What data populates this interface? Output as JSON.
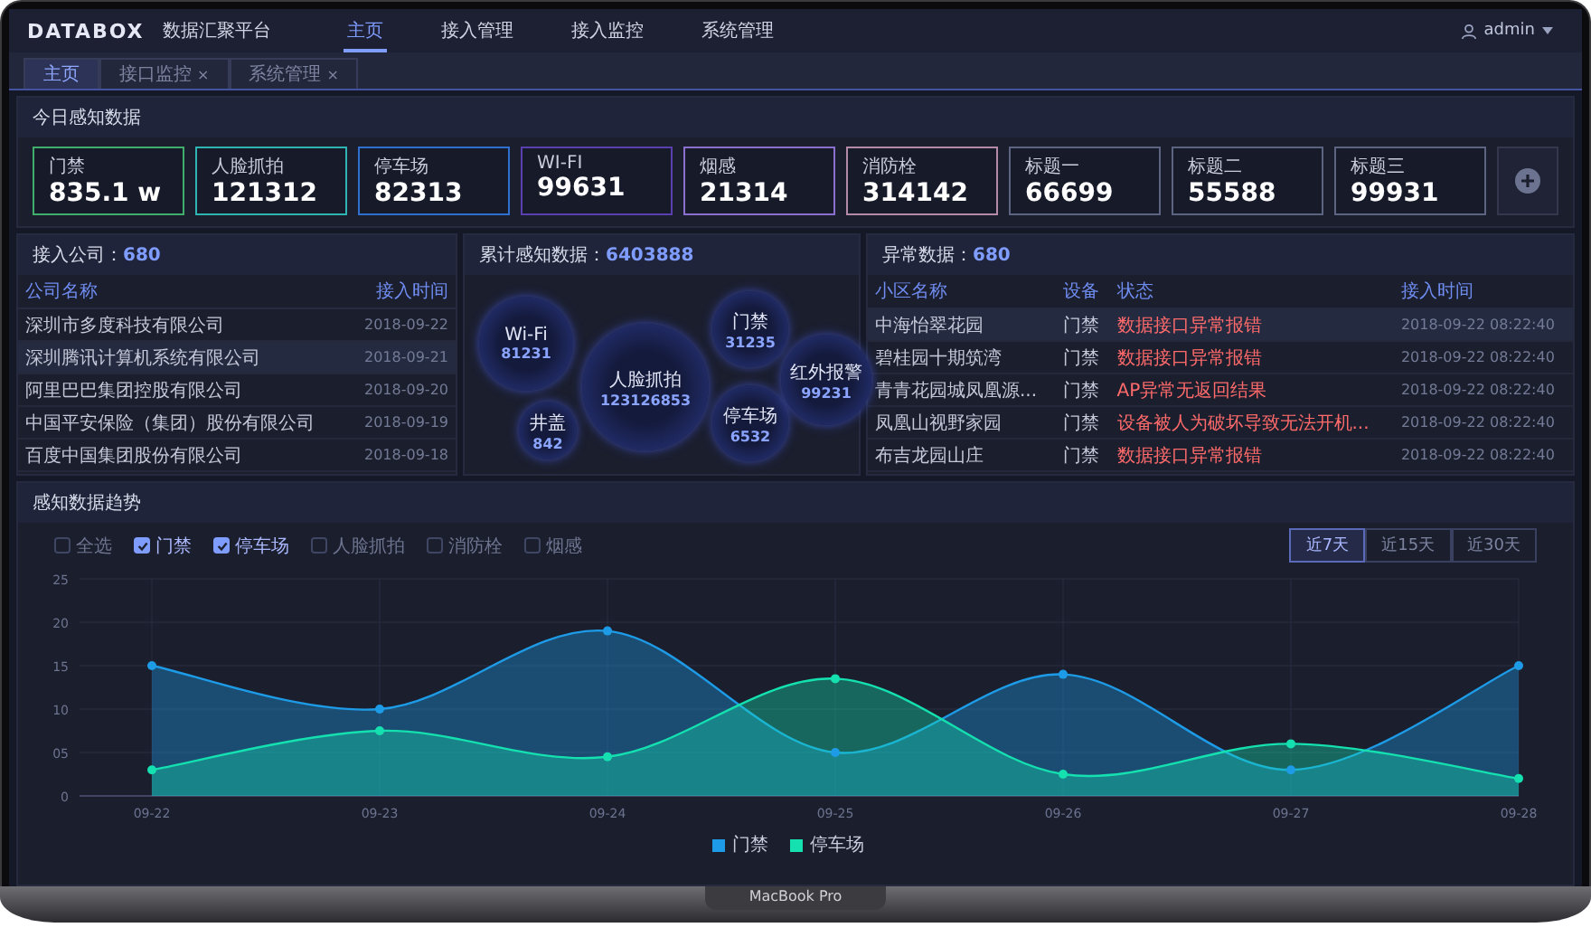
{
  "device": {
    "label": "MacBook Pro"
  },
  "header": {
    "logo": "DATABOX",
    "subtitle": "数据汇聚平台",
    "user": "admin",
    "nav": [
      {
        "label": "主页",
        "selected": true
      },
      {
        "label": "接入管理",
        "selected": false
      },
      {
        "label": "接入监控",
        "selected": false
      },
      {
        "label": "系统管理",
        "selected": false
      }
    ]
  },
  "tabs": [
    {
      "label": "主页",
      "selected": true
    },
    {
      "label": "接口监控",
      "close": "×",
      "selected": false
    },
    {
      "label": "系统管理",
      "close": "×",
      "selected": false
    }
  ],
  "today": {
    "title": "今日感知数据",
    "cards": [
      {
        "label": "门禁",
        "value": "835.1 w",
        "color": "#3fae6a"
      },
      {
        "label": "人脸抓拍",
        "value": "121312",
        "color": "#2fb3b3"
      },
      {
        "label": "停车场",
        "value": "82313",
        "color": "#2f6fd0"
      },
      {
        "label": "WI-FI",
        "value": "99631",
        "color": "#5a3fb0"
      },
      {
        "label": "烟感",
        "value": "21314",
        "color": "#8a6fd0"
      },
      {
        "label": "消防栓",
        "value": "314142",
        "color": "#b58aa8"
      },
      {
        "label": "标题一",
        "value": "66699",
        "color": "#5d6480"
      },
      {
        "label": "标题二",
        "value": "55588",
        "color": "#5d6480"
      },
      {
        "label": "标题三",
        "value": "99931",
        "color": "#5d6480"
      }
    ]
  },
  "companies": {
    "title": "接入公司：",
    "count": "680",
    "columns": [
      "公司名称",
      "接入时间"
    ],
    "rows": [
      {
        "cells": [
          "深圳市多度科技有限公司",
          "2018-09-22"
        ],
        "selected": false
      },
      {
        "cells": [
          "深圳腾讯计算机系统有限公司",
          "2018-09-21"
        ],
        "selected": true
      },
      {
        "cells": [
          "阿里巴巴集团控股有限公司",
          "2018-09-20"
        ],
        "selected": false
      },
      {
        "cells": [
          "中国平安保险（集团）股份有限公司",
          "2018-09-19"
        ],
        "selected": false
      },
      {
        "cells": [
          "百度中国集团股份有限公司",
          "2018-09-18"
        ],
        "selected": false
      }
    ]
  },
  "totals": {
    "title": "累计感知数据：",
    "count": "6403888",
    "bubbles": [
      {
        "label": "Wi-Fi",
        "value": "81231"
      },
      {
        "label": "井盖",
        "value": "842"
      },
      {
        "label": "人脸抓拍",
        "value": "123126853"
      },
      {
        "label": "门禁",
        "value": "31235"
      },
      {
        "label": "停车场",
        "value": "6532"
      },
      {
        "label": "红外报警",
        "value": "99231"
      }
    ]
  },
  "anomalies": {
    "title": "异常数据：",
    "count": "680",
    "columns": [
      "小区名称",
      "设备",
      "状态",
      "接入时间"
    ],
    "rows": [
      {
        "cells": [
          "中海怡翠花园",
          "门禁",
          "数据接口异常报错",
          "2018-09-22 08:22:40"
        ],
        "selected": true
      },
      {
        "cells": [
          "碧桂园十期筑湾",
          "门禁",
          "数据接口异常报错",
          "2018-09-22 08:22:40"
        ],
        "selected": false
      },
      {
        "cells": [
          "青青花园城凤凰源...",
          "门禁",
          "AP异常无返回结果",
          "2018-09-22 08:22:40"
        ],
        "selected": false
      },
      {
        "cells": [
          "凤凰山视野家园",
          "门禁",
          "设备被人为破坏导致无法开机...",
          "2018-09-22 08:22:40"
        ],
        "selected": false
      },
      {
        "cells": [
          "布吉龙园山庄",
          "门禁",
          "数据接口异常报错",
          "2018-09-22 08:22:40"
        ],
        "selected": false
      }
    ]
  },
  "trend": {
    "title": "感知数据趋势",
    "filters": [
      {
        "label": "全选",
        "checked": false
      },
      {
        "label": "门禁",
        "checked": true
      },
      {
        "label": "停车场",
        "checked": true
      },
      {
        "label": "人脸抓拍",
        "checked": false
      },
      {
        "label": "消防栓",
        "checked": false
      },
      {
        "label": "烟感",
        "checked": false
      }
    ],
    "ranges": [
      {
        "label": "近7天",
        "selected": true
      },
      {
        "label": "近15天",
        "selected": false
      },
      {
        "label": "近30天",
        "selected": false
      }
    ],
    "chart_data": {
      "type": "area",
      "categories": [
        "09-22",
        "09-23",
        "09-24",
        "09-25",
        "09-26",
        "09-27",
        "09-28"
      ],
      "series": [
        {
          "name": "门禁",
          "color": "#1e9be6",
          "values": [
            15,
            10,
            19,
            5,
            14,
            3,
            15
          ]
        },
        {
          "name": "停车场",
          "color": "#14e0b0",
          "values": [
            3,
            7.5,
            4.5,
            13.5,
            2.5,
            6,
            2
          ]
        }
      ],
      "ylim": [
        0,
        25
      ],
      "grid": true,
      "yticks": [
        0,
        {
          "value": 5,
          "label": "05"
        },
        10,
        15,
        20,
        25
      ]
    }
  }
}
